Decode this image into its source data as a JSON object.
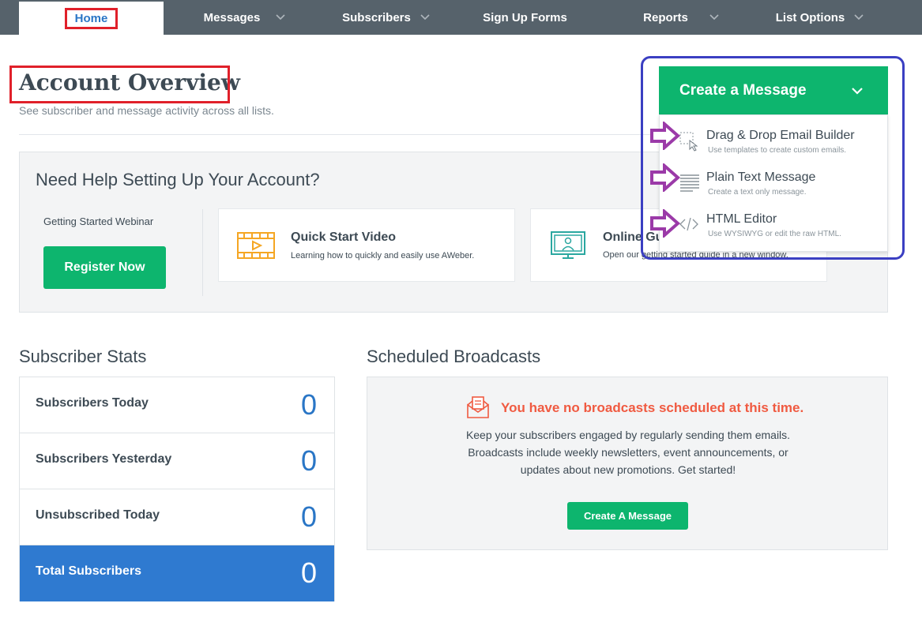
{
  "nav": {
    "items": [
      {
        "label": "Home",
        "has_chevron": false
      },
      {
        "label": "Messages",
        "has_chevron": true
      },
      {
        "label": "Subscribers",
        "has_chevron": true
      },
      {
        "label": "Sign Up Forms",
        "has_chevron": false
      },
      {
        "label": "Reports",
        "has_chevron": true
      },
      {
        "label": "List Options",
        "has_chevron": true
      }
    ]
  },
  "header": {
    "title": "Account Overview",
    "subtitle": "See subscriber and message activity across all lists."
  },
  "help": {
    "title": "Need Help Setting Up Your Account?",
    "webinar_label": "Getting Started Webinar",
    "register_label": "Register Now",
    "cards": [
      {
        "title": "Quick Start Video",
        "desc": "Learning how to quickly and easily use AWeber.",
        "icon": "video-icon"
      },
      {
        "title": "Online Gu",
        "desc": "Open our getting started guide in a new window.",
        "icon": "monitor-icon"
      }
    ]
  },
  "stats": {
    "title": "Subscriber Stats",
    "rows": [
      {
        "label": "Subscribers Today",
        "value": "0"
      },
      {
        "label": "Subscribers Yesterday",
        "value": "0"
      },
      {
        "label": "Unsubscribed Today",
        "value": "0"
      },
      {
        "label": "Total Subscribers",
        "value": "0"
      }
    ]
  },
  "scheduled": {
    "title": "Scheduled Broadcasts",
    "headline": "You have no broadcasts scheduled at this time.",
    "desc_lines": [
      "Keep your subscribers engaged by regularly sending them emails.",
      "Broadcasts include weekly newsletters, event announcements, or",
      "updates about new promotions. Get started!"
    ],
    "button_label": "Create A Message"
  },
  "dropdown": {
    "button_label": "Create a Message",
    "items": [
      {
        "title": "Drag & Drop Email Builder",
        "desc": "Use templates to create custom emails.",
        "icon": "drag-drop-icon"
      },
      {
        "title": "Plain Text Message",
        "desc": "Create a text only message.",
        "icon": "text-lines-icon"
      },
      {
        "title": "HTML Editor",
        "desc": "Use WYSIWYG or edit the raw HTML.",
        "icon": "code-icon"
      }
    ]
  },
  "colors": {
    "nav_bg": "#56626b",
    "green": "#0db56e",
    "blue": "#2a76c6",
    "total_row": "#2f7ad0",
    "alert": "#f05a41",
    "annotation_red": "#e0202a",
    "annotation_blue": "#3b3fc2",
    "annotation_purple": "#9b3aa8"
  }
}
